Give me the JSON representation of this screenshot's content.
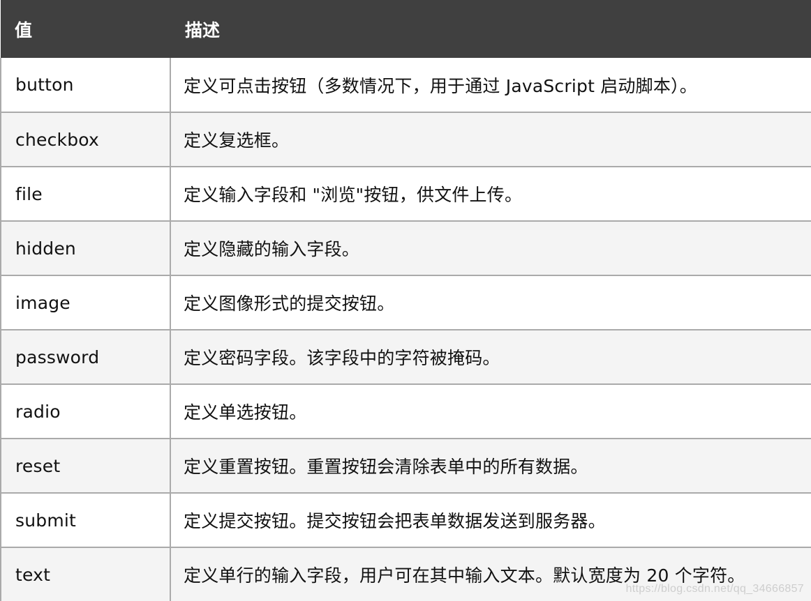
{
  "table": {
    "headers": {
      "value": "值",
      "description": "描述"
    },
    "rows": [
      {
        "value": "button",
        "description": "定义可点击按钮（多数情况下，用于通过 JavaScript 启动脚本）。"
      },
      {
        "value": "checkbox",
        "description": "定义复选框。"
      },
      {
        "value": "file",
        "description": "定义输入字段和 \"浏览\"按钮，供文件上传。"
      },
      {
        "value": "hidden",
        "description": "定义隐藏的输入字段。"
      },
      {
        "value": "image",
        "description": "定义图像形式的提交按钮。"
      },
      {
        "value": "password",
        "description": "定义密码字段。该字段中的字符被掩码。"
      },
      {
        "value": "radio",
        "description": "定义单选按钮。"
      },
      {
        "value": "reset",
        "description": "定义重置按钮。重置按钮会清除表单中的所有数据。"
      },
      {
        "value": "submit",
        "description": "定义提交按钮。提交按钮会把表单数据发送到服务器。"
      },
      {
        "value": "text",
        "description": "定义单行的输入字段，用户可在其中输入文本。默认宽度为 20 个字符。"
      }
    ]
  },
  "watermark": "https://blog.csdn.net/qq_34666857",
  "colors": {
    "header_bg": "#404040",
    "header_text": "#ffffff",
    "row_alt_bg": "#f4f4f4",
    "border": "#aaaaaa"
  }
}
